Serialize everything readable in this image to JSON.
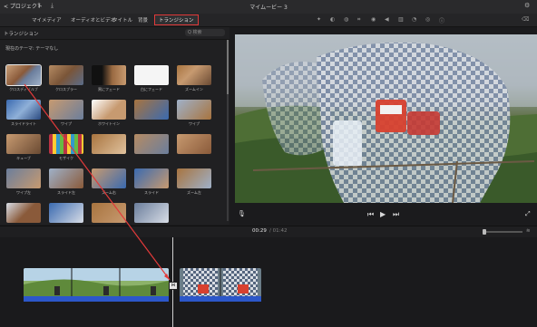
{
  "window": {
    "back_label": "< プロジェクト",
    "title": "マイムービー 3"
  },
  "toolbar": {
    "tabs": [
      {
        "label": "マイメディア",
        "active": false
      },
      {
        "label": "オーディオとビデオ",
        "active": false
      },
      {
        "label": "タイトル",
        "active": false
      },
      {
        "label": "背景",
        "active": false
      },
      {
        "label": "トランジション",
        "active": true
      }
    ],
    "icons": [
      "magic-wand-icon",
      "color-balance-icon",
      "color-correction-icon",
      "crop-icon",
      "stabilization-icon",
      "volume-icon",
      "noise-reduction-icon",
      "speed-icon",
      "filter-icon",
      "info-icon"
    ]
  },
  "transitions_panel": {
    "title": "トランジション",
    "search_placeholder": "Q 検索",
    "section_label": "現在のテーマ: テーマなし",
    "items": [
      {
        "label": "クロスディゾルブ",
        "selected": true
      },
      {
        "label": "クロスブラー",
        "selected": false
      },
      {
        "label": "黒にフェード",
        "selected": false
      },
      {
        "label": "白にフェード",
        "selected": false
      },
      {
        "label": "ズームイン",
        "selected": false
      },
      {
        "label": "スライドライト",
        "selected": false
      },
      {
        "label": "ワイプ",
        "selected": false
      },
      {
        "label": "ホワイトイン",
        "selected": false
      },
      {
        "label": "",
        "selected": false
      },
      {
        "label": "ワイプ",
        "selected": false
      },
      {
        "label": "キューブ",
        "selected": false
      },
      {
        "label": "モザイク",
        "selected": false
      },
      {
        "label": "",
        "selected": false
      },
      {
        "label": "",
        "selected": false
      },
      {
        "label": "",
        "selected": false
      },
      {
        "label": "ワイプ左",
        "selected": false
      },
      {
        "label": "スライド左",
        "selected": false
      },
      {
        "label": "ズーム右",
        "selected": false
      },
      {
        "label": "スライド",
        "selected": false
      },
      {
        "label": "ズーム左",
        "selected": false
      },
      {
        "label": "",
        "selected": false
      },
      {
        "label": "",
        "selected": false
      },
      {
        "label": "",
        "selected": false
      },
      {
        "label": "",
        "selected": false
      }
    ]
  },
  "viewer": {
    "play_label": "▶",
    "rewind_label": "⏮",
    "forward_label": "⏭"
  },
  "timeline": {
    "current_time": "00:29",
    "total_time": "/ 01:42",
    "transition_marker": "⋈"
  },
  "colors": {
    "accent_red": "#e23a3a",
    "audio_blue": "#2c57c9"
  }
}
